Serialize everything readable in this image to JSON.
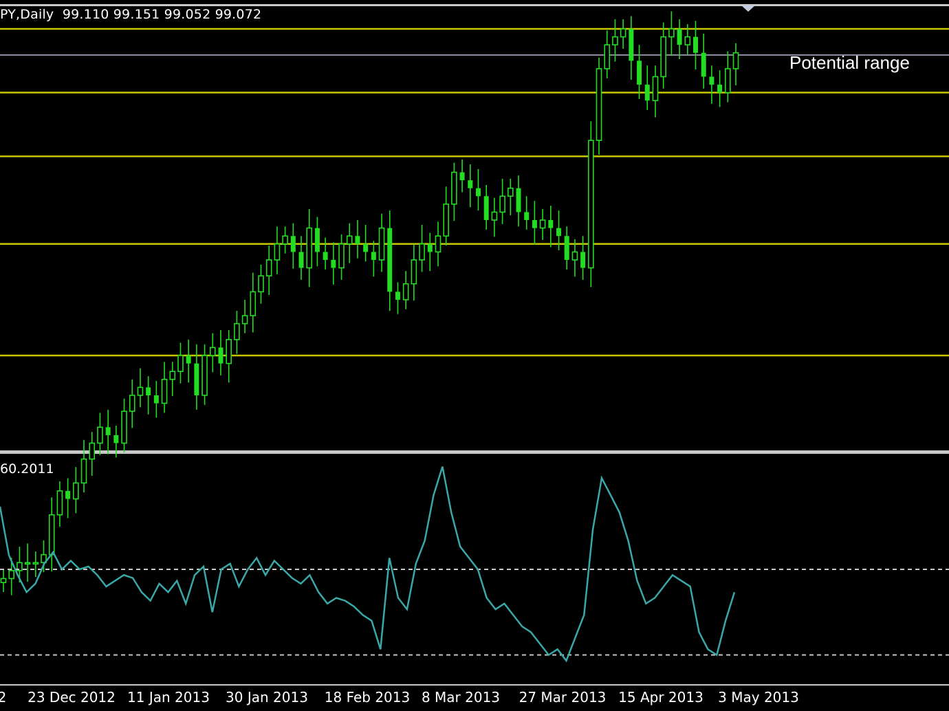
{
  "header": {
    "symbol_line": "PY,Daily  99.110 99.151 99.052 99.072"
  },
  "annotation": {
    "text": "Potential range"
  },
  "oscillator": {
    "label": "60.2011"
  },
  "colors": {
    "background": "#000000",
    "candle": "#22dd22",
    "level_line": "#c8c800",
    "price_line": "#8a8aa0",
    "oscillator_line": "#3aa8a8",
    "oscillator_levels": "#c8c8c8",
    "separator": "#c8c8c8"
  },
  "chart_data": [
    {
      "type": "candlestick",
      "title": "",
      "current_price": 99.072,
      "horizontal_levels": [
        99.4,
        98.6,
        97.8,
        96.7,
        95.3
      ],
      "y_range": [
        92.6,
        99.6
      ],
      "candle_closes": [
        92.5,
        92.6,
        92.7,
        92.7,
        92.7,
        92.8,
        93.3,
        93.6,
        93.5,
        93.7,
        94.0,
        94.2,
        94.4,
        94.3,
        94.2,
        94.6,
        94.8,
        94.9,
        94.8,
        94.7,
        95.0,
        95.1,
        95.3,
        95.2,
        94.8,
        95.3,
        95.4,
        95.2,
        95.5,
        95.7,
        95.8,
        96.1,
        96.3,
        96.5,
        96.7,
        96.8,
        96.6,
        96.4,
        96.9,
        96.6,
        96.5,
        96.4,
        96.7,
        96.8,
        96.7,
        96.6,
        96.5,
        96.9,
        96.1,
        96.0,
        96.2,
        96.5,
        96.7,
        96.6,
        96.8,
        97.2,
        97.6,
        97.5,
        97.4,
        97.3,
        97.0,
        97.1,
        97.3,
        97.4,
        97.1,
        97.0,
        96.9,
        97.0,
        96.9,
        96.8,
        96.5,
        96.6,
        96.4,
        98.0,
        98.9,
        99.2,
        99.3,
        99.4,
        99.0,
        98.7,
        98.5,
        98.8,
        99.3,
        99.4,
        99.2,
        99.3,
        99.1,
        98.8,
        98.7,
        98.6,
        98.9,
        99.1
      ]
    },
    {
      "type": "line",
      "title": "",
      "series": [
        {
          "values": [
            82,
            65,
            58,
            52,
            55,
            62,
            66,
            60,
            63,
            60,
            61,
            58,
            54,
            56,
            58,
            57,
            52,
            49,
            55,
            52,
            56,
            48,
            58,
            61,
            45,
            60,
            62,
            54,
            60,
            64,
            58,
            63,
            60,
            57,
            55,
            58,
            52,
            48,
            50,
            49,
            47,
            44,
            42,
            32,
            64,
            50,
            46,
            62,
            70,
            86,
            96,
            80,
            68,
            64,
            60,
            50,
            46,
            48,
            44,
            40,
            38,
            34,
            30,
            32,
            28,
            36,
            44,
            74,
            92,
            86,
            80,
            70,
            56,
            48,
            50,
            54,
            58,
            56,
            54,
            38,
            32,
            30,
            42,
            52
          ]
        }
      ],
      "levels": [
        60,
        30
      ],
      "ylim": [
        20,
        100
      ]
    }
  ],
  "x_axis": {
    "ticks": [
      "2",
      "23 Dec 2012",
      "11 Jan 2013",
      "30 Jan 2013",
      "18 Feb 2013",
      "8 Mar 2013",
      "27 Mar 2013",
      "15 Apr 2013",
      "3 May 2013"
    ]
  }
}
